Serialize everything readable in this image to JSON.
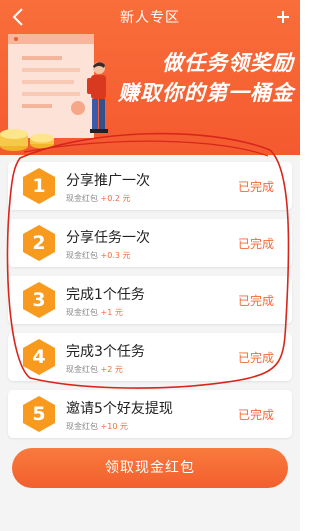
{
  "nav": {
    "title": "新人专区"
  },
  "banner": {
    "slogan_line1": "做任务领奖励",
    "slogan_line2": "赚取你的第一桶金"
  },
  "tasks": [
    {
      "number": "1",
      "title": "分享推广一次",
      "reward_label": "现金红包",
      "reward_amount": "+0.2 元",
      "status": "已完成"
    },
    {
      "number": "2",
      "title": "分享任务一次",
      "reward_label": "现金红包",
      "reward_amount": "+0.3 元",
      "status": "已完成"
    },
    {
      "number": "3",
      "title": "完成1个任务",
      "reward_label": "现金红包",
      "reward_amount": "+1 元",
      "status": "已完成"
    },
    {
      "number": "4",
      "title": "完成3个任务",
      "reward_label": "现金红包",
      "reward_amount": "+2 元",
      "status": "已完成"
    },
    {
      "number": "5",
      "title": "邀请5个好友提现",
      "reward_label": "现金红包",
      "reward_amount": "+10 元",
      "status": "已完成"
    }
  ],
  "claim_button": {
    "label": "领取现金红包"
  },
  "colors": {
    "brand_orange": "#f45a2f",
    "accent_orange": "#f46a3a",
    "hex_orange": "#f79a1e",
    "annotation_red": "#d8261c"
  },
  "icons": {
    "back": "back-arrow-icon",
    "plus": "plus-icon"
  }
}
